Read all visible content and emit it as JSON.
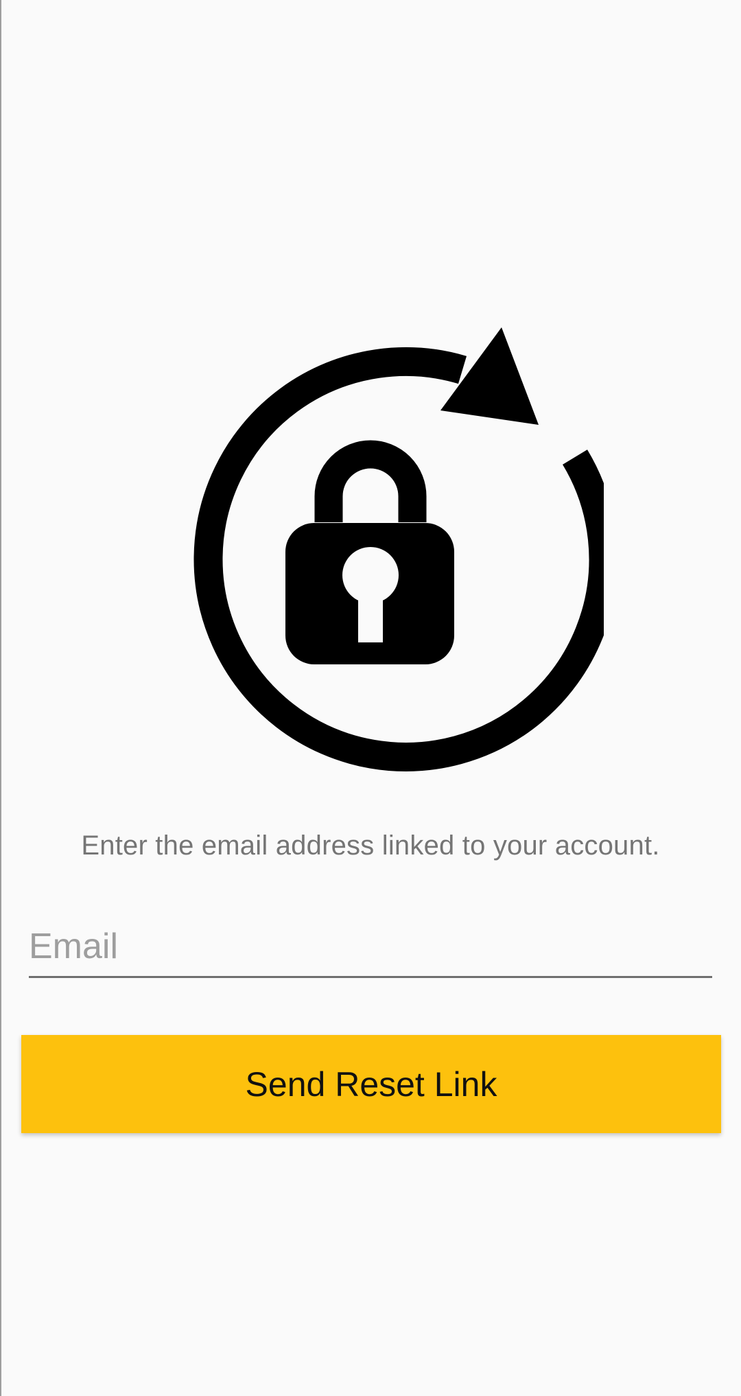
{
  "reset_screen": {
    "icon": "lock-reset-icon",
    "instruction": "Enter the email address linked to your account.",
    "email_placeholder": "Email",
    "email_value": "",
    "send_button_label": "Send Reset Link"
  },
  "colors": {
    "background": "#fafafa",
    "accent": "#fdc10d",
    "icon": "#000000",
    "instruction_text": "#757575",
    "placeholder": "#9e9e9e"
  }
}
